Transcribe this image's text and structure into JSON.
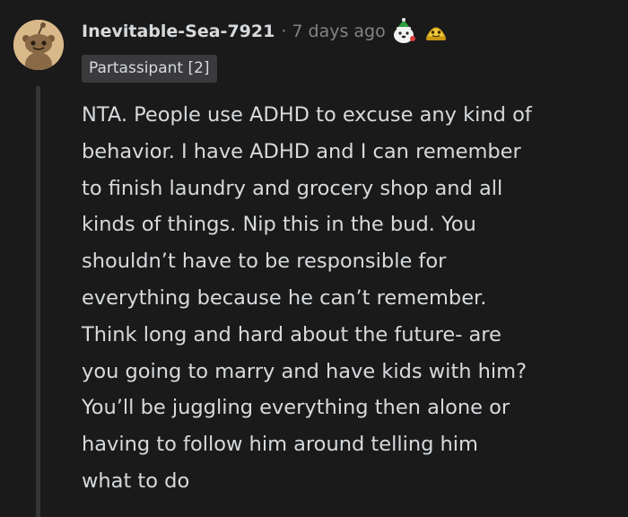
{
  "comment": {
    "author": "Inevitable-Sea-7921",
    "separator": "·",
    "timestamp": "7 days ago",
    "flair": "Partassipant [2]",
    "awards": [
      {
        "name": "wholesome-seal-award-icon"
      },
      {
        "name": "gold-award-icon"
      }
    ],
    "avatar_icon": "snoo-avatar-icon",
    "body_lines": [
      "NTA. People use ADHD to excuse any kind of",
      "behavior. I have ADHD and I can remember",
      "to finish laundry and grocery shop and all",
      "kinds of things. Nip this in the bud. You",
      "shouldn’t have to be responsible for",
      "everything because he can’t remember.",
      "Think long and hard about the future- are",
      "you going to marry and have kids with him?",
      "You’ll be juggling everything then alone or",
      "having to follow him around telling him",
      "what to do"
    ]
  },
  "colors": {
    "background": "#1a1a1b",
    "text": "#d7dadc",
    "meta": "#818384",
    "flair_bg": "#3a3a3c",
    "thread_line": "#343536",
    "avatar_bg": "#d9b98a"
  }
}
